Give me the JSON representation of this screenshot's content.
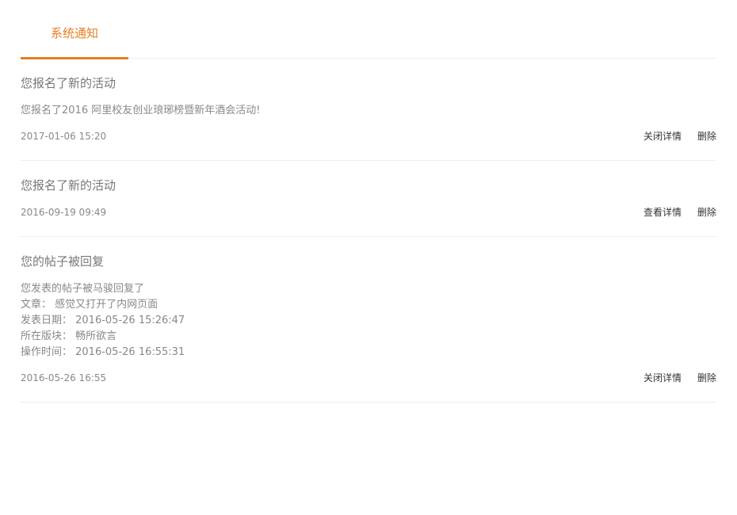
{
  "tabs": [
    {
      "label": "系统通知"
    }
  ],
  "notices": [
    {
      "title": "您报名了新的活动",
      "body": [
        "您报名了2016 阿里校友创业琅琊榜暨新年酒会活动!"
      ],
      "time": "2017-01-06 15:20",
      "detail_label": "关闭详情",
      "delete_label": "删除"
    },
    {
      "title": "您报名了新的活动",
      "body": [],
      "time": "2016-09-19 09:49",
      "detail_label": "查看详情",
      "delete_label": "删除"
    },
    {
      "title": "您的帖子被回复",
      "body": [
        "您发表的帖子被马骏回复了",
        "文章： 感觉又打开了内网页面",
        "发表日期： 2016-05-26 15:26:47",
        "所在版块： 畅所欲言",
        "操作时间： 2016-05-26 16:55:31"
      ],
      "time": "2016-05-26 16:55",
      "detail_label": "关闭详情",
      "delete_label": "删除"
    }
  ],
  "colors": {
    "accent": "#e67e22",
    "divider": "#eeeeee"
  }
}
